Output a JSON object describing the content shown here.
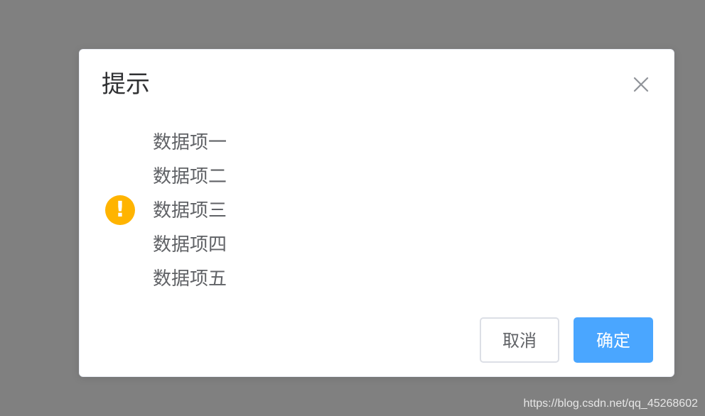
{
  "dialog": {
    "title": "提示",
    "close_icon": "close-icon",
    "status_icon": "warning-icon",
    "status_symbol": "!",
    "messages": [
      "数据项一",
      "数据项二",
      "数据项三",
      "数据项四",
      "数据项五"
    ],
    "cancel_label": "取消",
    "confirm_label": "确定"
  },
  "watermark": "https://blog.csdn.net/qq_45268602",
  "colors": {
    "overlay": "#808080",
    "warning": "#ffb400",
    "primary": "#4aa6ff"
  }
}
